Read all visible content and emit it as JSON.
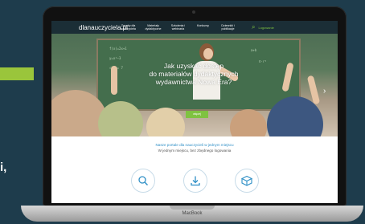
{
  "side": {
    "text": "i,"
  },
  "nav": {
    "logo": "dlanauczyciela.pl",
    "items": [
      "Zasoby dla nauczyciela",
      "Materiały dydaktyczne",
      "Szkolenia i webinaria",
      "Konkursy",
      "Dzienniki i publikacje"
    ],
    "login": "Logowanie"
  },
  "hero": {
    "title_line1": "Jak uzyskać dostęp",
    "title_line2": "do materiałów dydaktycznych",
    "title_line3": "wydawnictwa Nowa Era?",
    "button": "więcej"
  },
  "lower": {
    "line1": "Nasze portale dla nauczycieli w jednym miejscu",
    "line2": "W jednym miejscu, bez zbędnego logowania"
  },
  "icons": [
    "search-icon",
    "download-icon",
    "box-icon"
  ],
  "laptop": {
    "brand": "MacBook"
  },
  "colors": {
    "accent_green": "#7fc241",
    "background": "#1e3c4c",
    "nav": "#1b2e36",
    "link_blue": "#2e8fc6"
  }
}
